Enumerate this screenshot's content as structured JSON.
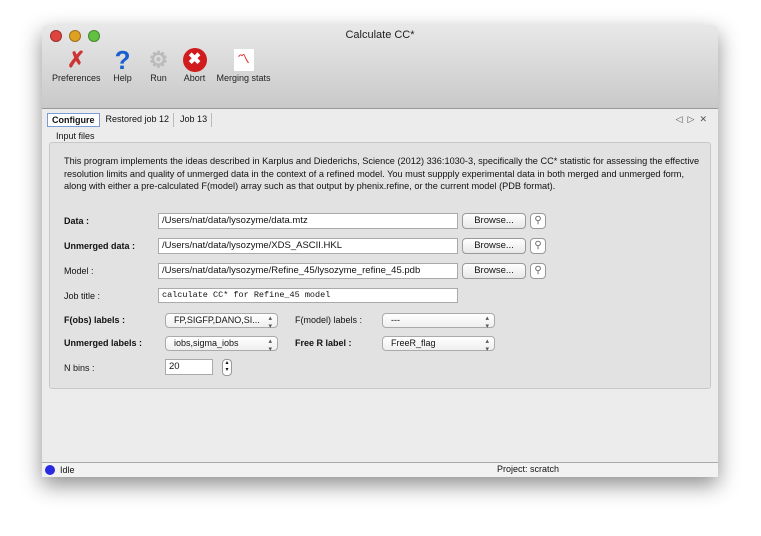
{
  "window": {
    "title": "Calculate CC*"
  },
  "toolbar": [
    {
      "label": "Preferences",
      "icon": "tools-icon"
    },
    {
      "label": "Help",
      "icon": "help-icon"
    },
    {
      "label": "Run",
      "icon": "gear-icon"
    },
    {
      "label": "Abort",
      "icon": "abort-icon"
    },
    {
      "label": "Merging stats",
      "icon": "chart-icon"
    }
  ],
  "tabs": [
    {
      "label": "Configure",
      "active": true
    },
    {
      "label": "Restored job 12"
    },
    {
      "label": "Job 13"
    }
  ],
  "section": "Input files",
  "description": "This program implements the ideas described in Karplus and Diederichs, Science (2012) 336:1030-3, specifically the CC* statistic for assessing the effective resolution limits and quality of unmerged data in the context of a refined model.  You must suppply experimental data in both merged and unmerged form, along with either a pre-calculated F(model) array such as that output by phenix.refine, or the current model (PDB format).",
  "fields": {
    "data": {
      "label": "Data :",
      "value": "/Users/nat/data/lysozyme/data.mtz"
    },
    "unmerged": {
      "label": "Unmerged data :",
      "value": "/Users/nat/data/lysozyme/XDS_ASCII.HKL"
    },
    "model": {
      "label": "Model :",
      "value": "/Users/nat/data/lysozyme/Refine_45/lysozyme_refine_45.pdb"
    },
    "job_title": {
      "label": "Job title :",
      "value": "calculate CC* for Refine_45 model"
    },
    "fobs": {
      "label": "F(obs) labels :",
      "value": "FP,SIGFP,DANO,SI..."
    },
    "fmodel": {
      "label": "F(model) labels :",
      "value": "---"
    },
    "unmerged_labels": {
      "label": "Unmerged labels :",
      "value": "iobs,sigma_iobs"
    },
    "free_r": {
      "label": "Free R label :",
      "value": "FreeR_flag"
    },
    "nbins": {
      "label": "N bins :",
      "value": "20"
    }
  },
  "browse_label": "Browse...",
  "status": {
    "state": "Idle",
    "project": "Project: scratch",
    "indicator_color": "#2a2ae0"
  }
}
